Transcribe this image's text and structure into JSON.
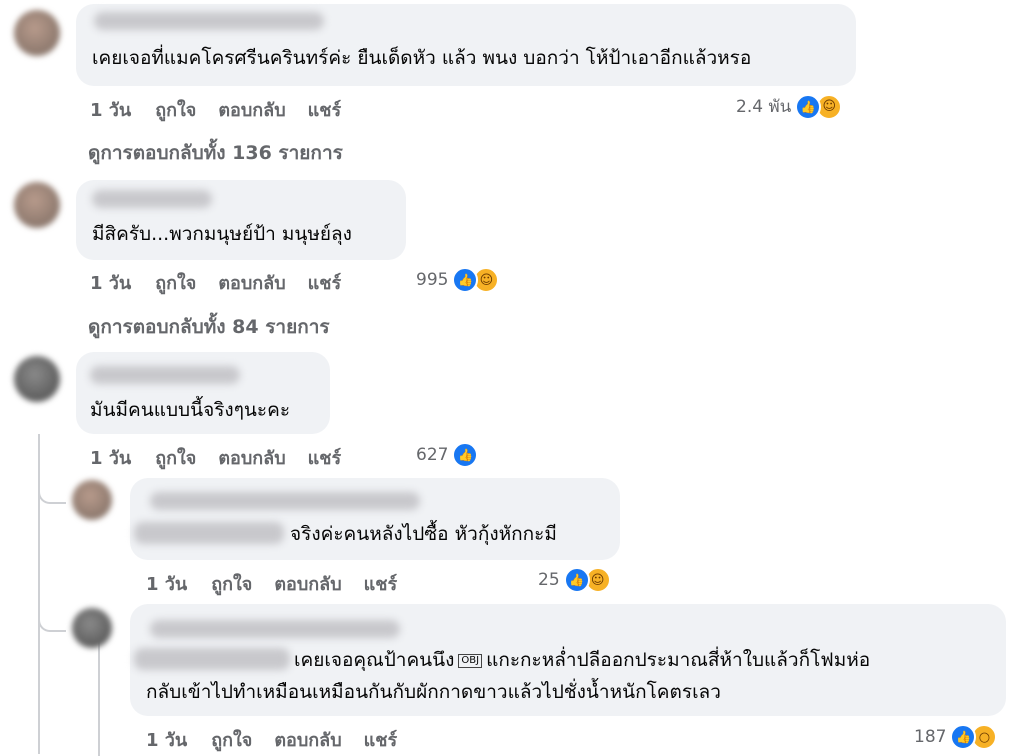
{
  "comments": [
    {
      "text": "เคยเจอที่แมคโครศรีนครินทร์ค่ะ ยืนเด็ดหัว แล้ว พนง บอกว่า โห้ป้าเอาอีกแล้วหรอ",
      "time": "1 วัน",
      "like": "ถูกใจ",
      "reply": "ตอบกลับ",
      "share": "แชร์",
      "reaction_count": "2.4 พัน",
      "reactions": [
        "like-icon",
        "haha-icon"
      ],
      "view_replies": "ดูการตอบกลับทั้ง 136 รายการ"
    },
    {
      "text": "มีสิครับ...พวกมนุษย์ป้า มนุษย์ลุง",
      "time": "1 วัน",
      "like": "ถูกใจ",
      "reply": "ตอบกลับ",
      "share": "แชร์",
      "reaction_count": "995",
      "reactions": [
        "like-icon",
        "haha-icon"
      ],
      "view_replies": "ดูการตอบกลับทั้ง 84 รายการ"
    },
    {
      "text": "มันมีคนแบบนี้จริงๆนะคะ",
      "time": "1 วัน",
      "like": "ถูกใจ",
      "reply": "ตอบกลับ",
      "share": "แชร์",
      "reaction_count": "627",
      "reactions": [
        "like-icon"
      ]
    }
  ],
  "replies": [
    {
      "text": "จริงค่ะคนหลังไปซื้อ หัวกุ้งหักกะมี",
      "time": "1 วัน",
      "like": "ถูกใจ",
      "reply": "ตอบกลับ",
      "share": "แชร์",
      "reaction_count": "25",
      "reactions": [
        "like-icon",
        "haha-icon"
      ]
    },
    {
      "text_line1_a": "เคยเจอคุณป้าคนนึง",
      "obj": "OBJ",
      "text_line1_b": "แกะกะหล่ำปลีออกประมาณสี่ห้าใบแล้วก็โฟมห่อ",
      "text_line2": "กลับเข้าไปทำเหมือนเหมือนกันกับผักกาดขาวแล้วไปชั่งน้ำหนักโคตรเลว",
      "time": "1 วัน",
      "like": "ถูกใจ",
      "reply": "ตอบกลับ",
      "share": "แชร์",
      "reaction_count": "187",
      "reactions": [
        "like-icon",
        "wow-icon"
      ]
    }
  ],
  "colors": {
    "bubble": "#f0f2f5",
    "like": "#1877f2",
    "haha": "#f7b125",
    "meta": "#65676b"
  }
}
